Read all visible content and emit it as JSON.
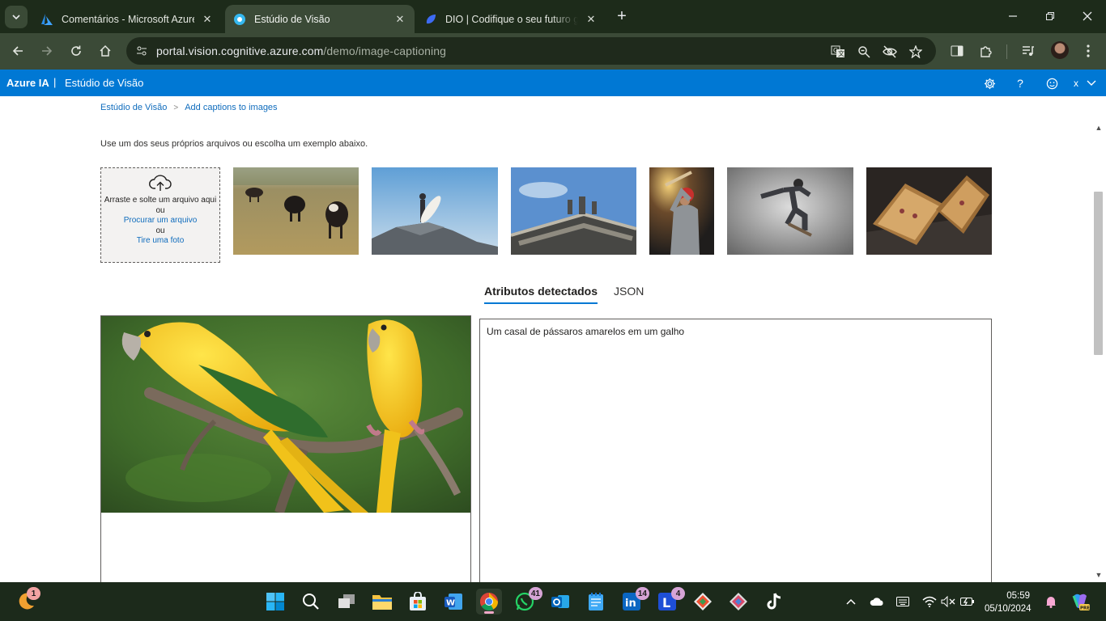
{
  "browser": {
    "tabs": [
      {
        "title": "Comentários - Microsoft Azure",
        "active": false
      },
      {
        "title": "Estúdio de Visão",
        "active": true
      },
      {
        "title": "DIO | Codifique o seu futuro gl",
        "active": false
      }
    ],
    "url_host": "portal.vision.cognitive.azure.com",
    "url_path": "/demo/image-captioning"
  },
  "azure_header": {
    "brand": "Azure IA",
    "separator": "|",
    "studio": "Estúdio de Visão",
    "user_initial": "x"
  },
  "breadcrumb": {
    "root": "Estúdio de Visão",
    "current": "Add captions to images"
  },
  "intro_text": "Use um dos seus próprios arquivos ou escolha um exemplo abaixo.",
  "dropzone": {
    "drag_text": "Arraste e solte um arquivo aqui",
    "or1": "ou",
    "browse_link": "Procurar um arquivo",
    "or2": "ou",
    "photo_link": "Tire uma foto"
  },
  "result_tabs": {
    "attributes": "Atributos detectados",
    "json": "JSON"
  },
  "caption": "Um casal de pássaros amarelos em um galho",
  "taskbar": {
    "badges": {
      "app1": "1",
      "whatsapp": "41",
      "linkedin": "14",
      "lapp": "4"
    },
    "time": "05:59",
    "date": "05/10/2024"
  },
  "colors": {
    "azure_blue": "#0078d4",
    "link_blue": "#0f6cbd",
    "chrome_frame": "#1d2b1a",
    "chrome_toolbar": "#3b4a37"
  }
}
